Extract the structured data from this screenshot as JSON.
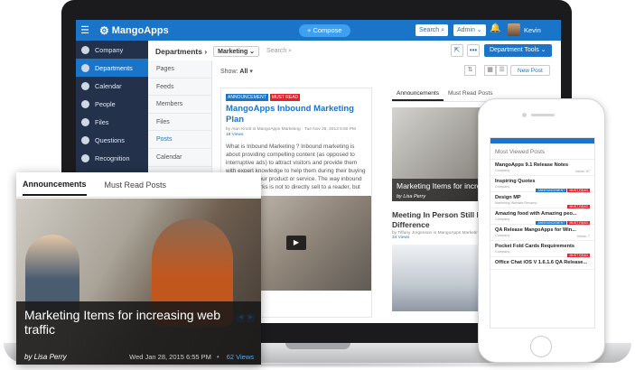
{
  "app": {
    "name": "MangoApps",
    "compose": "Compose",
    "search_btn": "Search",
    "admin_btn": "Admin",
    "user": "Kevin"
  },
  "sidebar": {
    "items": [
      {
        "label": "Company",
        "icon": "company-icon"
      },
      {
        "label": "Departments",
        "icon": "departments-icon"
      },
      {
        "label": "Calendar",
        "icon": "calendar-icon"
      },
      {
        "label": "People",
        "icon": "people-icon"
      },
      {
        "label": "Files",
        "icon": "files-icon"
      },
      {
        "label": "Questions",
        "icon": "questions-icon"
      },
      {
        "label": "Recognition",
        "icon": "recognition-icon"
      }
    ]
  },
  "header": {
    "crumb": "Departments ›",
    "dept": "Marketing",
    "search_placeholder": "Search",
    "tools": "Department Tools"
  },
  "submenu": [
    "Pages",
    "Feeds",
    "Members",
    "Files",
    "Posts",
    "Calendar"
  ],
  "toolbar": {
    "show_label": "Show:",
    "show_value": "All",
    "new_post": "New Post"
  },
  "post": {
    "tags": [
      "ANNOUNCEMENT",
      "MUST READ"
    ],
    "title": "MangoApps Inbound Marketing Plan",
    "meta": "by Alan Knott in MangoApps Marketing · Tue Nov 26, 2013 5:50 PM",
    "views": "18 Views",
    "body": "What is Inbound Marketing ? Inbound marketing is about providing compelling content (as opposed to interruptive ads) to attract visitors and provide them with expert knowledge to help them during their buying process for your product or service. The way inbound marketing works is not to directly sell to a reader, but"
  },
  "feed": {
    "tabs": [
      "Announcements",
      "Must Read Posts"
    ],
    "feature_title": "Marketing Items for increasing web traffic",
    "feature_by": "by Lisa Perry",
    "meeting_title": "Meeting In Person Still Makes a Difference",
    "meeting_meta": "by Tiffany Jorgenson in MangoApps Marketing",
    "meeting_views": "34 Views"
  },
  "overlay": {
    "tabs": [
      "Announcements",
      "Must Read Posts"
    ],
    "title": "Marketing Items for increasing web traffic",
    "by": "by Lisa Perry",
    "date": "Wed Jan 28, 2015 6:55 PM",
    "views": "62 Views"
  },
  "phone": {
    "heading": "Most Viewed Posts",
    "items": [
      {
        "title": "MangoApps 9.1 Release Notes",
        "sub": "Company",
        "views": "Views: 57",
        "tags": []
      },
      {
        "title": "Inspiring Quotes",
        "sub": "Company",
        "views": "Views: 21",
        "tags": [
          "ANNOUNCEMENT",
          "MUST READ"
        ]
      },
      {
        "title": "Design MP",
        "sub": "Marketing Website Revamp",
        "views": "Views: 16",
        "tags": [
          "MUST READ"
        ]
      },
      {
        "title": "Amazing food with Amazing peo...",
        "sub": "Company",
        "views": "Views: 13",
        "tags": [
          "ANNOUNCEMENT",
          "MUST READ"
        ]
      },
      {
        "title": "QA Release MangoApps for Win...",
        "sub": "Company",
        "views": "Views: 7",
        "tags": []
      },
      {
        "title": "Pocket Fold Cards Requirements",
        "sub": "Company",
        "views": "Views: 6",
        "tags": [
          "MUST READ"
        ]
      },
      {
        "title": "Office Chat iOS V 1.6.1.6 QA Release...",
        "sub": "",
        "views": "",
        "tags": []
      }
    ]
  },
  "colors": {
    "brand": "#1a75c9",
    "sidebar": "#23324a",
    "must_read": "#e0242e"
  }
}
